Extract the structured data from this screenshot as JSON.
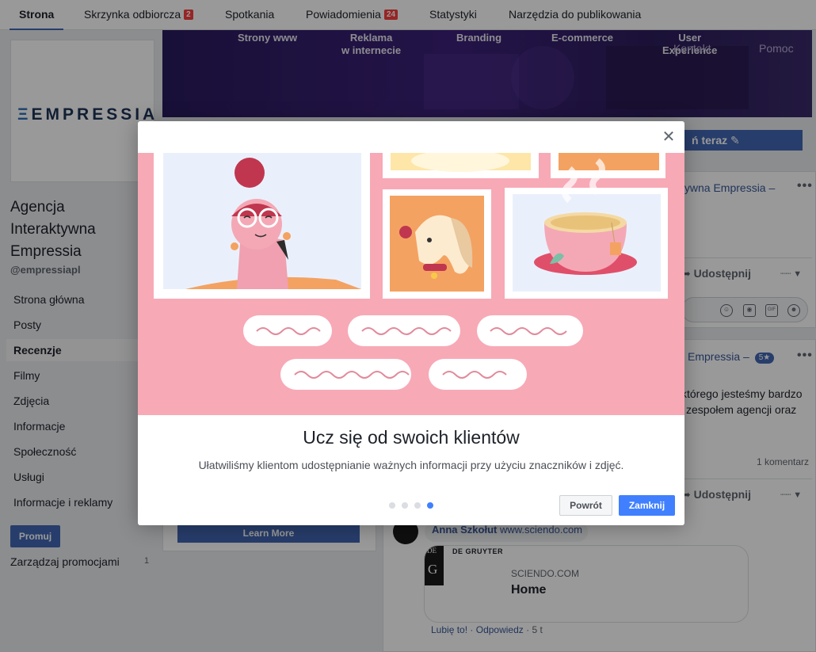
{
  "tabs": [
    {
      "label": "Strona"
    },
    {
      "label": "Skrzynka odbiorcza",
      "badge": "2"
    },
    {
      "label": "Spotkania"
    },
    {
      "label": "Powiadomienia",
      "badge": "24"
    },
    {
      "label": "Statystyki"
    },
    {
      "label": "Narzędzia do publikowania"
    }
  ],
  "page": {
    "logo_text": "EMPRESSIA",
    "name": "Agencja Interaktywna Empressia",
    "handle": "@empressiapl"
  },
  "nav": {
    "items": [
      {
        "label": "Strona główna"
      },
      {
        "label": "Posty"
      },
      {
        "label": "Recenzje"
      },
      {
        "label": "Filmy"
      },
      {
        "label": "Zdjęcia"
      },
      {
        "label": "Informacje"
      },
      {
        "label": "Społeczność"
      },
      {
        "label": "Usługi"
      },
      {
        "label": "Informacje i reklamy"
      }
    ],
    "promote_label": "Promuj",
    "manage_promotions": "Zarządzaj promocjami",
    "manage_count": "1"
  },
  "cover": {
    "items": [
      "Strony www",
      "Reklama\nw internecie",
      "Branding",
      "E-commerce",
      "User\nExperience"
    ],
    "faded": "Kontakt",
    "help": "Pomoc"
  },
  "cta": {
    "label": "ń teraz ✎"
  },
  "feed": {
    "post1_title": "tywna Empressia –",
    "share_label": "Udostępnij",
    "post2_title": "Empressia –",
    "post2_rating": "5★",
    "post2_text_1": "którego jesteśmy bardzo",
    "post2_text_2": "zespołem agencji oraz",
    "comments_count": "1 komentarz",
    "learn_more": "Learn More",
    "comment_author": "Anna Szkołut",
    "comment_link": "www.sciendo.com",
    "card_publisher": "DE GRUYTER",
    "card_domain": "SCIENDO.COM",
    "card_title": "Home",
    "action_like": "Lubię to!",
    "action_reply": "Odpowiedz",
    "action_time": "5 t"
  },
  "modal": {
    "title": "Ucz się od swoich klientów",
    "subtitle": "Ułatwiliśmy klientom udostępnianie ważnych informacji przy użyciu znaczników i zdjęć.",
    "back_label": "Powrót",
    "close_label": "Zamknij",
    "pager_total": 4,
    "pager_active": 4
  },
  "colors": {
    "brand": "#4267b2",
    "illustration_bg": "#f8a9b6",
    "primary_button": "#4080ff"
  }
}
